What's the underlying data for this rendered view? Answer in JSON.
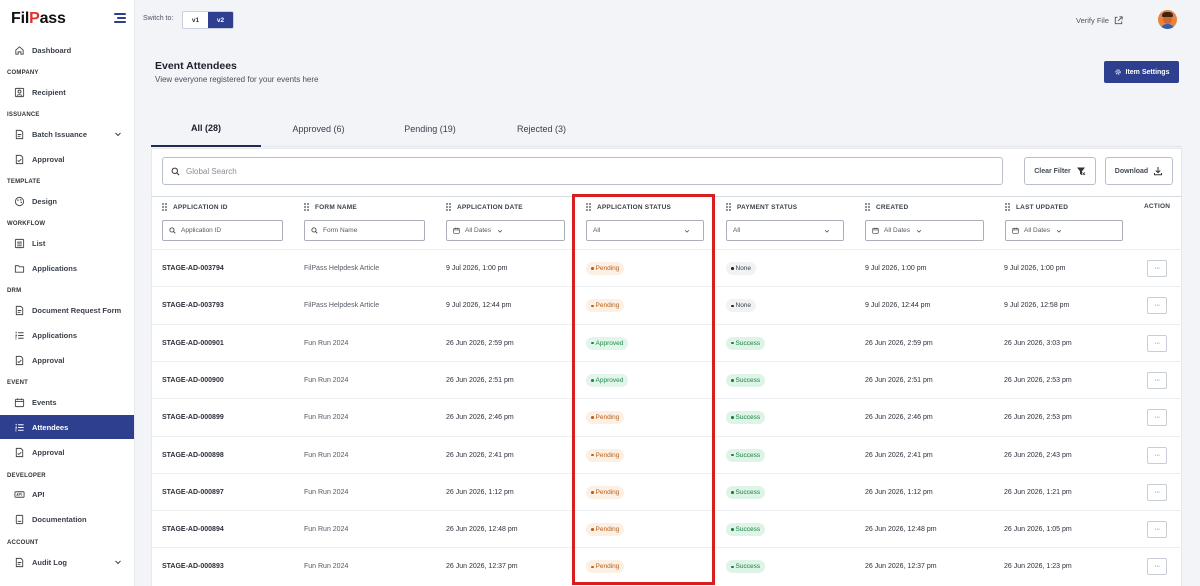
{
  "app": {
    "logo_left": "Fil",
    "logo_v": "P",
    "logo_right": "ass"
  },
  "topbar": {
    "switch_label": "Switch to:",
    "versions": [
      "v1",
      "v2"
    ],
    "active_version": "v2",
    "verify_label": "Verify File"
  },
  "sidebar": {
    "dashboard": "Dashboard",
    "sections": {
      "company": "COMPANY",
      "issuance": "ISSUANCE",
      "template": "TEMPLATE",
      "workflow": "WORKFLOW",
      "drm": "DRM",
      "event": "EVENT",
      "developer": "DEVELOPER",
      "account": "ACCOUNT"
    },
    "items": {
      "recipient": "Recipient",
      "batch_issuance": "Batch Issuance",
      "issuance_approval": "Approval",
      "design": "Design",
      "list": "List",
      "workflow_applications": "Applications",
      "document_request_form": "Document Request Form",
      "drm_applications": "Applications",
      "drm_approval": "Approval",
      "events": "Events",
      "attendees": "Attendees",
      "event_approval": "Approval",
      "api": "API",
      "documentation": "Documentation",
      "audit_log": "Audit Log"
    },
    "active_item": "Attendees"
  },
  "page": {
    "title": "Event Attendees",
    "subtitle": "View everyone registered for your events here",
    "item_settings": "Item Settings"
  },
  "tabs": [
    {
      "label": "All (28)",
      "active": true
    },
    {
      "label": "Approved (6)",
      "active": false
    },
    {
      "label": "Pending (19)",
      "active": false
    },
    {
      "label": "Rejected (3)",
      "active": false
    }
  ],
  "toolbar": {
    "search_placeholder": "Global Search",
    "clear_filter": "Clear Filter",
    "download": "Download"
  },
  "table": {
    "columns": {
      "application_id": "APPLICATION ID",
      "form_name": "FORM NAME",
      "application_date": "APPLICATION DATE",
      "application_status": "APPLICATION STATUS",
      "payment_status": "PAYMENT STATUS",
      "created": "CREATED",
      "last_updated": "LAST UPDATED",
      "action": "ACTION"
    },
    "filters": {
      "application_id_placeholder": "Application ID",
      "form_name_placeholder": "Form Name",
      "application_date": "All Dates",
      "application_status": "All",
      "payment_status": "All",
      "created": "All Dates",
      "last_updated": "All Dates"
    },
    "action_label": "···",
    "rows": [
      {
        "id": "STAGE-AD-003794",
        "form": "FilPass Helpdesk Article",
        "app_date": "9 Jul 2026, 1:00 pm",
        "status": "Pending",
        "payment": "None",
        "created": "9 Jul 2026, 1:00 pm",
        "updated": "9 Jul 2026, 1:00 pm"
      },
      {
        "id": "STAGE-AD-003793",
        "form": "FilPass Helpdesk Article",
        "app_date": "9 Jul 2026, 12:44 pm",
        "status": "Pending",
        "payment": "None",
        "created": "9 Jul 2026, 12:44 pm",
        "updated": "9 Jul 2026, 12:58 pm"
      },
      {
        "id": "STAGE-AD-000901",
        "form": "Fun Run 2024",
        "app_date": "26 Jun 2026, 2:59 pm",
        "status": "Approved",
        "payment": "Success",
        "created": "26 Jun 2026, 2:59 pm",
        "updated": "26 Jun 2026, 3:03 pm"
      },
      {
        "id": "STAGE-AD-000900",
        "form": "Fun Run 2024",
        "app_date": "26 Jun 2026, 2:51 pm",
        "status": "Approved",
        "payment": "Success",
        "created": "26 Jun 2026, 2:51 pm",
        "updated": "26 Jun 2026, 2:53 pm"
      },
      {
        "id": "STAGE-AD-000899",
        "form": "Fun Run 2024",
        "app_date": "26 Jun 2026, 2:46 pm",
        "status": "Pending",
        "payment": "Success",
        "created": "26 Jun 2026, 2:46 pm",
        "updated": "26 Jun 2026, 2:53 pm"
      },
      {
        "id": "STAGE-AD-000898",
        "form": "Fun Run 2024",
        "app_date": "26 Jun 2026, 2:41 pm",
        "status": "Pending",
        "payment": "Success",
        "created": "26 Jun 2026, 2:41 pm",
        "updated": "26 Jun 2026, 2:43 pm"
      },
      {
        "id": "STAGE-AD-000897",
        "form": "Fun Run 2024",
        "app_date": "26 Jun 2026, 1:12 pm",
        "status": "Pending",
        "payment": "Success",
        "created": "26 Jun 2026, 1:12 pm",
        "updated": "26 Jun 2026, 1:21 pm"
      },
      {
        "id": "STAGE-AD-000894",
        "form": "Fun Run 2024",
        "app_date": "26 Jun 2026, 12:48 pm",
        "status": "Pending",
        "payment": "Success",
        "created": "26 Jun 2026, 12:48 pm",
        "updated": "26 Jun 2026, 1:05 pm"
      },
      {
        "id": "STAGE-AD-000893",
        "form": "Fun Run 2024",
        "app_date": "26 Jun 2026, 12:37 pm",
        "status": "Pending",
        "payment": "Success",
        "created": "26 Jun 2026, 12:37 pm",
        "updated": "26 Jun 2026, 1:23 pm"
      }
    ]
  },
  "colors": {
    "primary": "#2e3f8f",
    "highlight": "#d81e1e",
    "pending": "#b8621a",
    "approved": "#1e8a47"
  }
}
